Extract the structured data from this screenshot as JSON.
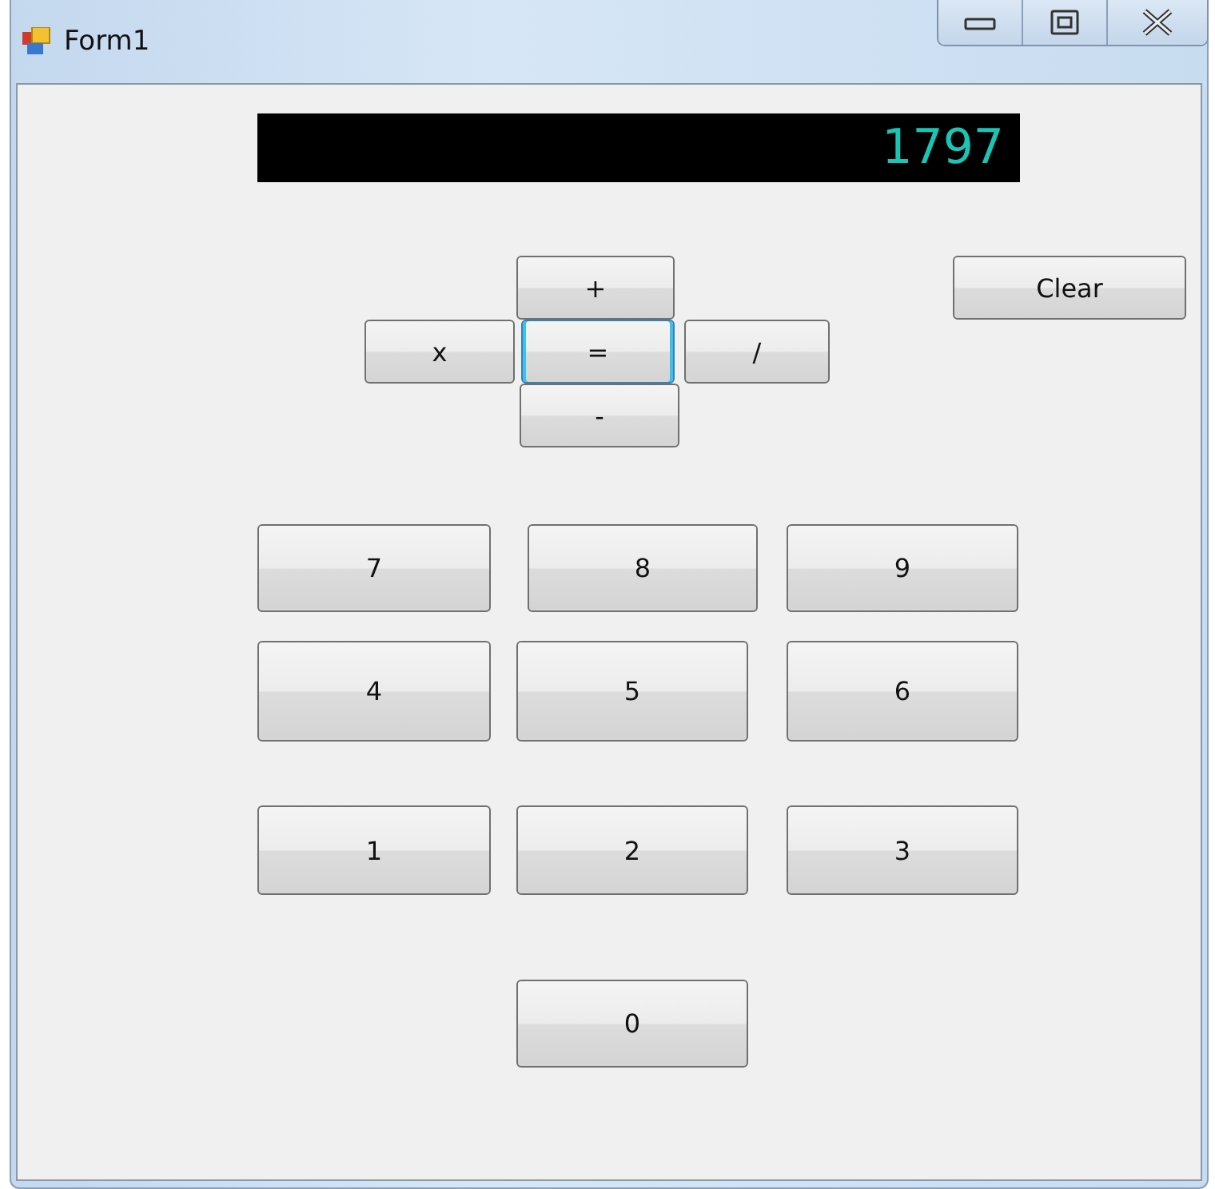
{
  "window": {
    "title": "Form1"
  },
  "display": {
    "value": "1797"
  },
  "operator_rows": [
    [
      {
        "label": "+",
        "focused": false
      },
      {
        "label": "Clear",
        "focused": false
      }
    ],
    [
      {
        "label": "x",
        "focused": false
      },
      {
        "label": "=",
        "focused": true
      },
      {
        "label": "/",
        "focused": false
      }
    ],
    [
      {
        "label": "-",
        "focused": false
      }
    ]
  ],
  "digit_rows": [
    [
      {
        "label": "7"
      },
      {
        "label": "8"
      },
      {
        "label": "9"
      }
    ],
    [
      {
        "label": "4"
      },
      {
        "label": "5"
      },
      {
        "label": "6"
      }
    ],
    [
      {
        "label": "1"
      },
      {
        "label": "2"
      },
      {
        "label": "3"
      }
    ],
    [
      {
        "label": "0"
      }
    ]
  ]
}
